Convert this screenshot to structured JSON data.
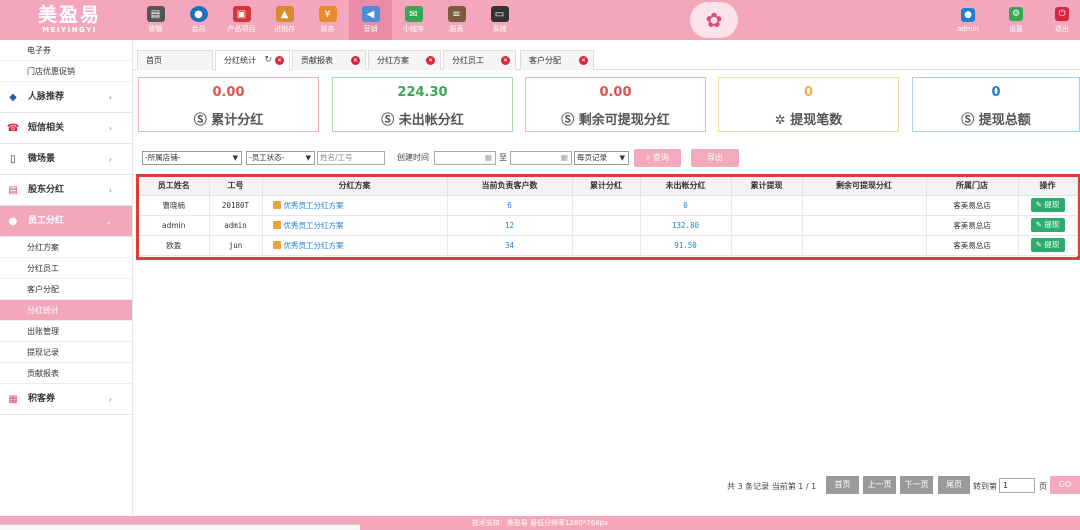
{
  "logo": {
    "cn": "美盈易",
    "en": "MEIYINGYI"
  },
  "nav": [
    {
      "label": "收银",
      "icon": "cashier-icon",
      "color": "#555555"
    },
    {
      "label": "会员",
      "icon": "member-icon",
      "color": "#1f6fbf"
    },
    {
      "label": "产品项目",
      "icon": "product-icon",
      "color": "#d8343a"
    },
    {
      "label": "进销存",
      "icon": "inventory-icon",
      "color": "#d98a2b"
    },
    {
      "label": "财务",
      "icon": "finance-icon",
      "color": "#e98a2b"
    },
    {
      "label": "营销",
      "icon": "marketing-icon",
      "color": "#4a8fd6"
    },
    {
      "label": "小程序",
      "icon": "mini-program-icon",
      "color": "#35a853"
    },
    {
      "label": "报表",
      "icon": "report-icon",
      "color": "#7a5a3a"
    },
    {
      "label": "系统",
      "icon": "system-icon",
      "color": "#333333"
    }
  ],
  "top_right": {
    "admin": "admin",
    "settings": "设置",
    "logout": "退出"
  },
  "sidebar": {
    "top_subs": [
      "电子券",
      "门店优惠促销"
    ],
    "menus": [
      {
        "label": "人脉推荐",
        "icon": "layers-icon",
        "color": "#2b5d9a"
      },
      {
        "label": "短信相关",
        "icon": "phone-icon",
        "color": "#d9263f"
      },
      {
        "label": "微场景",
        "icon": "mobile-icon",
        "color": "#333333"
      },
      {
        "label": "股东分红",
        "icon": "document-icon",
        "color": "#e0457b"
      }
    ],
    "open_menu": {
      "label": "员工分红",
      "icon": "person-icon"
    },
    "open_subs": [
      "分红方案",
      "分红员工",
      "客户分配",
      "分红统计",
      "出账管理",
      "提现记录",
      "贡献报表"
    ],
    "active_sub": "分红统计",
    "last_menu": {
      "label": "积客券",
      "icon": "coupon-icon"
    }
  },
  "tabs": [
    {
      "label": "首页"
    },
    {
      "label": "分红统计",
      "active": true
    },
    {
      "label": "贡献报表"
    },
    {
      "label": "分红方案"
    },
    {
      "label": "分红员工"
    },
    {
      "label": "客户分配"
    }
  ],
  "stats": [
    {
      "value": "0.00",
      "label": "累计分红",
      "color": "#e05252",
      "border": "#f1b3b3",
      "icon": "coin-icon"
    },
    {
      "value": "224.30",
      "label": "未出帐分红",
      "color": "#3aa757",
      "border": "#a8d8b0",
      "icon": "coin-icon"
    },
    {
      "value": "0.00",
      "label": "剩余可提现分红",
      "color": "#e05252",
      "border": "#f1b3b3",
      "icon": "coin-icon"
    },
    {
      "value": "0",
      "label": "提现笔数",
      "color": "#f0ad4e",
      "border": "#f6d7a8",
      "icon": "gear-icon"
    },
    {
      "value": "0",
      "label": "提现总额",
      "color": "#1f7fd6",
      "border": "#a8cfee",
      "icon": "coin-icon"
    }
  ],
  "filters": {
    "store": "-所属店铺-",
    "status": "-员工状态-",
    "name_placeholder": "姓名/工号",
    "created_label": "创建时间",
    "to_label": "至",
    "per_page": "每页记录",
    "search": "查询",
    "export": "导出"
  },
  "table": {
    "headers": [
      "员工姓名",
      "工号",
      "分红方案",
      "当前负责客户数",
      "累计分红",
      "未出帐分红",
      "累计提现",
      "剩余可提现分红",
      "所属门店",
      "操作"
    ],
    "rows": [
      {
        "name": "曹晓楠",
        "id": "20180T",
        "plan": "优秀员工分红方案",
        "customers": "6",
        "total": "",
        "unposted": "0",
        "withdrawn": "",
        "remaining": "",
        "store": "客美易总店",
        "action": "提现"
      },
      {
        "name": "admin",
        "id": "admin",
        "plan": "优秀员工分红方案",
        "customers": "12",
        "total": "",
        "unposted": "132.80",
        "withdrawn": "",
        "remaining": "",
        "store": "客美易总店",
        "action": "提现"
      },
      {
        "name": "欧盈",
        "id": "jun",
        "plan": "优秀员工分红方案",
        "customers": "34",
        "total": "",
        "unposted": "91.50",
        "withdrawn": "",
        "remaining": "",
        "store": "客美易总店",
        "action": "提现"
      }
    ]
  },
  "pagination": {
    "summary": "共 3 条记录 当前第 1 / 1",
    "first": "首页",
    "prev": "上一页",
    "next": "下一页",
    "last": "尾页",
    "goto": "转到第",
    "page_value": "1",
    "page_unit": "页",
    "go": "GO"
  },
  "footer": "技术支持：美盈易    最低分辨率1280*768px",
  "colors": {
    "brand_pink": "#f4a6bd",
    "active_pink": "#f2a7bd",
    "highlight_border": "#e23b3b",
    "action_green": "#2eab6f",
    "link_blue": "#1f7fd6"
  }
}
